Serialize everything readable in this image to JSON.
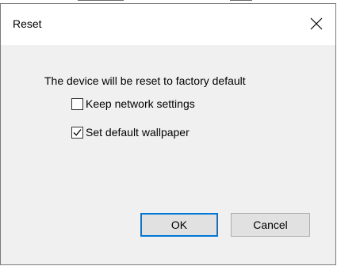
{
  "dialog": {
    "title": "Reset",
    "message": "The device will be reset to factory default",
    "options": [
      {
        "label": "Keep network settings",
        "checked": false
      },
      {
        "label": "Set default wallpaper",
        "checked": true
      }
    ],
    "buttons": {
      "ok_label": "OK",
      "cancel_label": "Cancel"
    },
    "close_icon": "close-icon"
  },
  "colors": {
    "accent": "#0078d7",
    "dialog_background": "#f0f0f0",
    "titlebar_background": "#ffffff"
  }
}
